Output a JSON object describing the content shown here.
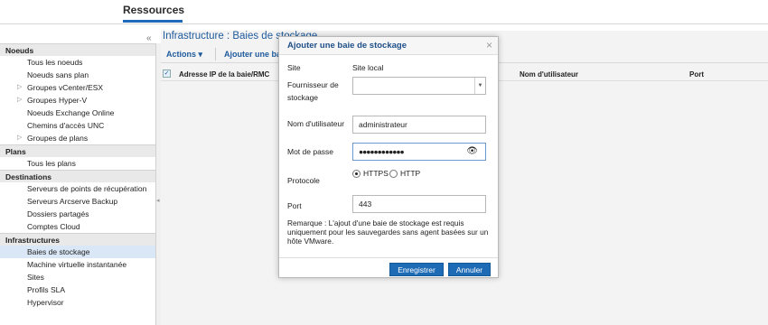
{
  "app": {
    "title": "Ressources"
  },
  "sidebar": {
    "sections": [
      {
        "header": "Noeuds",
        "items": [
          {
            "label": "Tous les noeuds"
          },
          {
            "label": "Noeuds sans plan"
          },
          {
            "label": "Groupes vCenter/ESX",
            "expandable": true
          },
          {
            "label": "Groupes Hyper-V",
            "expandable": true
          },
          {
            "label": "Noeuds Exchange Online"
          },
          {
            "label": "Chemins d'accès UNC"
          },
          {
            "label": "Groupes de plans",
            "expandable": true
          }
        ]
      },
      {
        "header": "Plans",
        "items": [
          {
            "label": "Tous les plans"
          }
        ]
      },
      {
        "header": "Destinations",
        "items": [
          {
            "label": "Serveurs de points de récupération"
          },
          {
            "label": "Serveurs Arcserve Backup"
          },
          {
            "label": "Dossiers partagés"
          },
          {
            "label": "Comptes Cloud"
          }
        ]
      },
      {
        "header": "Infrastructures",
        "items": [
          {
            "label": "Baies de stockage",
            "selected": true
          },
          {
            "label": "Machine virtuelle instantanée"
          },
          {
            "label": "Sites"
          },
          {
            "label": "Profils SLA"
          },
          {
            "label": "Hypervisor"
          }
        ]
      }
    ]
  },
  "main": {
    "heading": "Infrastructure : Baies de stockage",
    "toolbar": {
      "actions": "Actions",
      "add": "Ajouter une baie de stockage"
    },
    "columns": {
      "address": "Adresse IP de la baie/RMC",
      "username": "Nom d'utilisateur",
      "port": "Port"
    }
  },
  "dialog": {
    "title": "Ajouter une baie de stockage",
    "site_label": "Site",
    "site_value": "Site local",
    "vendor_label": "Fournisseur de stockage",
    "vendor_value": "",
    "username_label": "Nom d'utilisateur",
    "username_value": "administrateur",
    "password_label": "Mot de passe",
    "password_value": "●●●●●●●●●●●●",
    "protocol_label": "Protocole",
    "protocol_https": "HTTPS",
    "protocol_http": "HTTP",
    "protocol_selected": "HTTPS",
    "port_label": "Port",
    "port_value": "443",
    "note": "Remarque : L'ajout d'une baie de stockage est requis uniquement pour les sauvegardes sans agent basées sur un hôte VMware.",
    "save": "Enregistrer",
    "cancel": "Annuler"
  },
  "colors": {
    "accent": "#1d6bb5",
    "heading": "#1e5a9c",
    "selected_row": "#d9e7f6"
  }
}
